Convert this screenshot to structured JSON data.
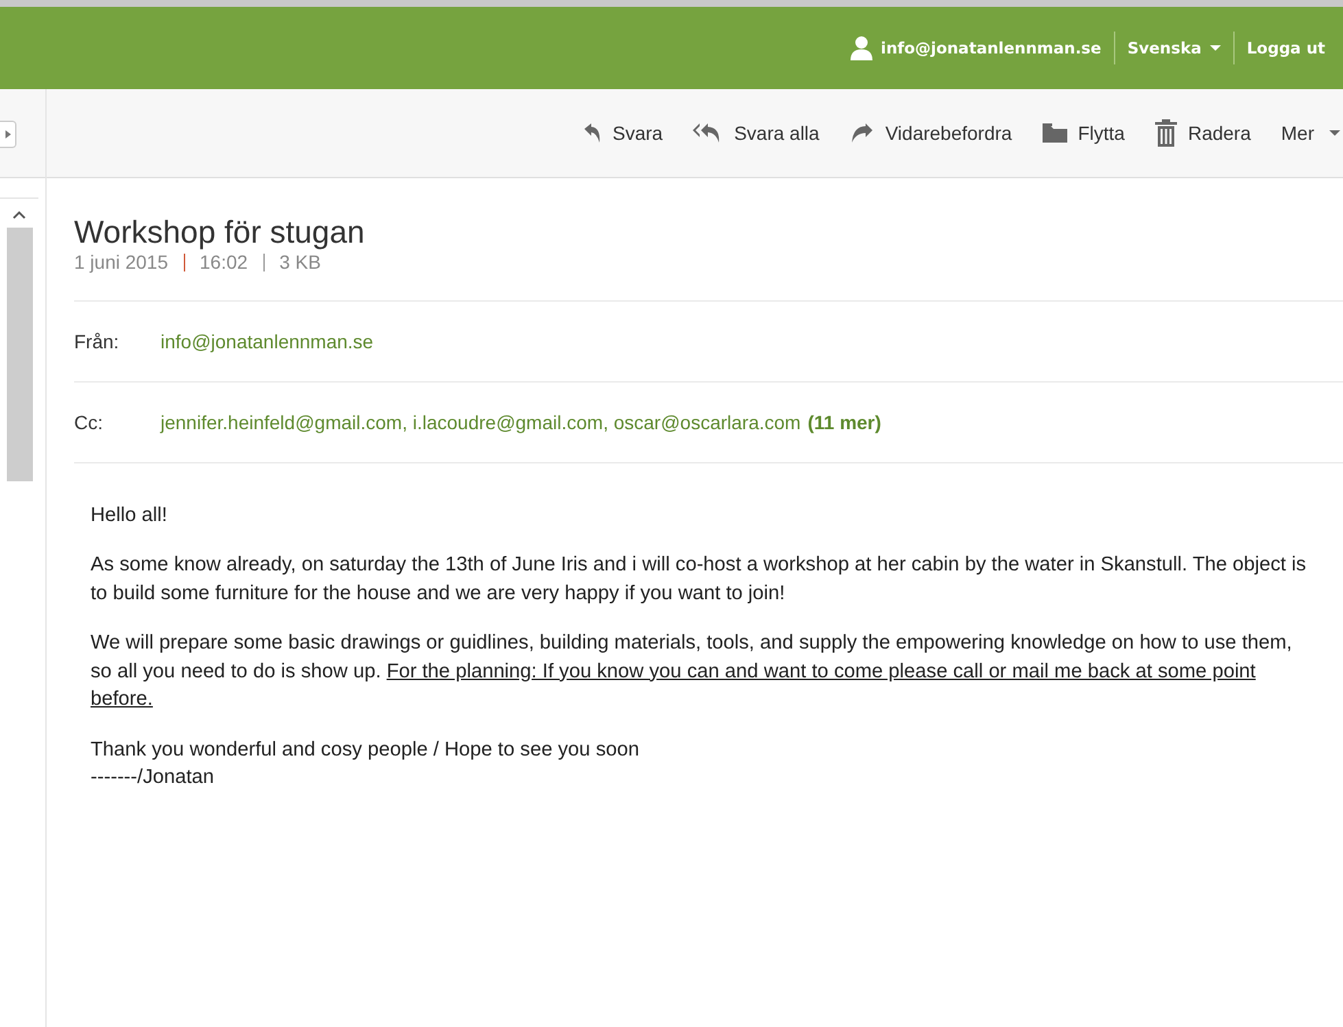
{
  "header": {
    "user": "info@jonatanlennman.se",
    "language": "Svenska",
    "logout": "Logga ut"
  },
  "toolbar": [
    {
      "kind": "reply",
      "label": "Svara"
    },
    {
      "kind": "reply-all",
      "label": "Svara alla"
    },
    {
      "kind": "forward",
      "label": "Vidarebefordra"
    },
    {
      "kind": "move",
      "label": "Flytta"
    },
    {
      "kind": "delete",
      "label": "Radera"
    },
    {
      "kind": "more",
      "label": "Mer"
    }
  ],
  "message": {
    "subject": "Workshop för stugan",
    "date": "1 juni 2015",
    "time": "16:02",
    "size": "3 KB",
    "from_label": "Från:",
    "from": "info@jonatanlennman.se",
    "cc_label": "Cc:",
    "cc": "jennifer.heinfeld@gmail.com, i.lacoudre@gmail.com, oscar@oscarlara.com",
    "cc_more": "(11 mer)",
    "body": [
      {
        "text": "Hello all!"
      },
      {
        "text": "As some know already, on saturday the 13th of June Iris and i will co-host a workshop at her cabin by the water in Skanstull. The object is to build some furniture for the house and we are very happy if you want to join!"
      },
      {
        "text": "We will prepare some basic drawings or guidlines, building materials, tools, and supply the empowering knowledge on how to use them, so all you need to do is show up. ",
        "underlined": "For the planning: If you know you can and want to come please call or mail me back at some point before."
      },
      {
        "text": "Thank you wonderful and cosy people / Hope to see you soon\n-------/Jonatan"
      }
    ]
  }
}
